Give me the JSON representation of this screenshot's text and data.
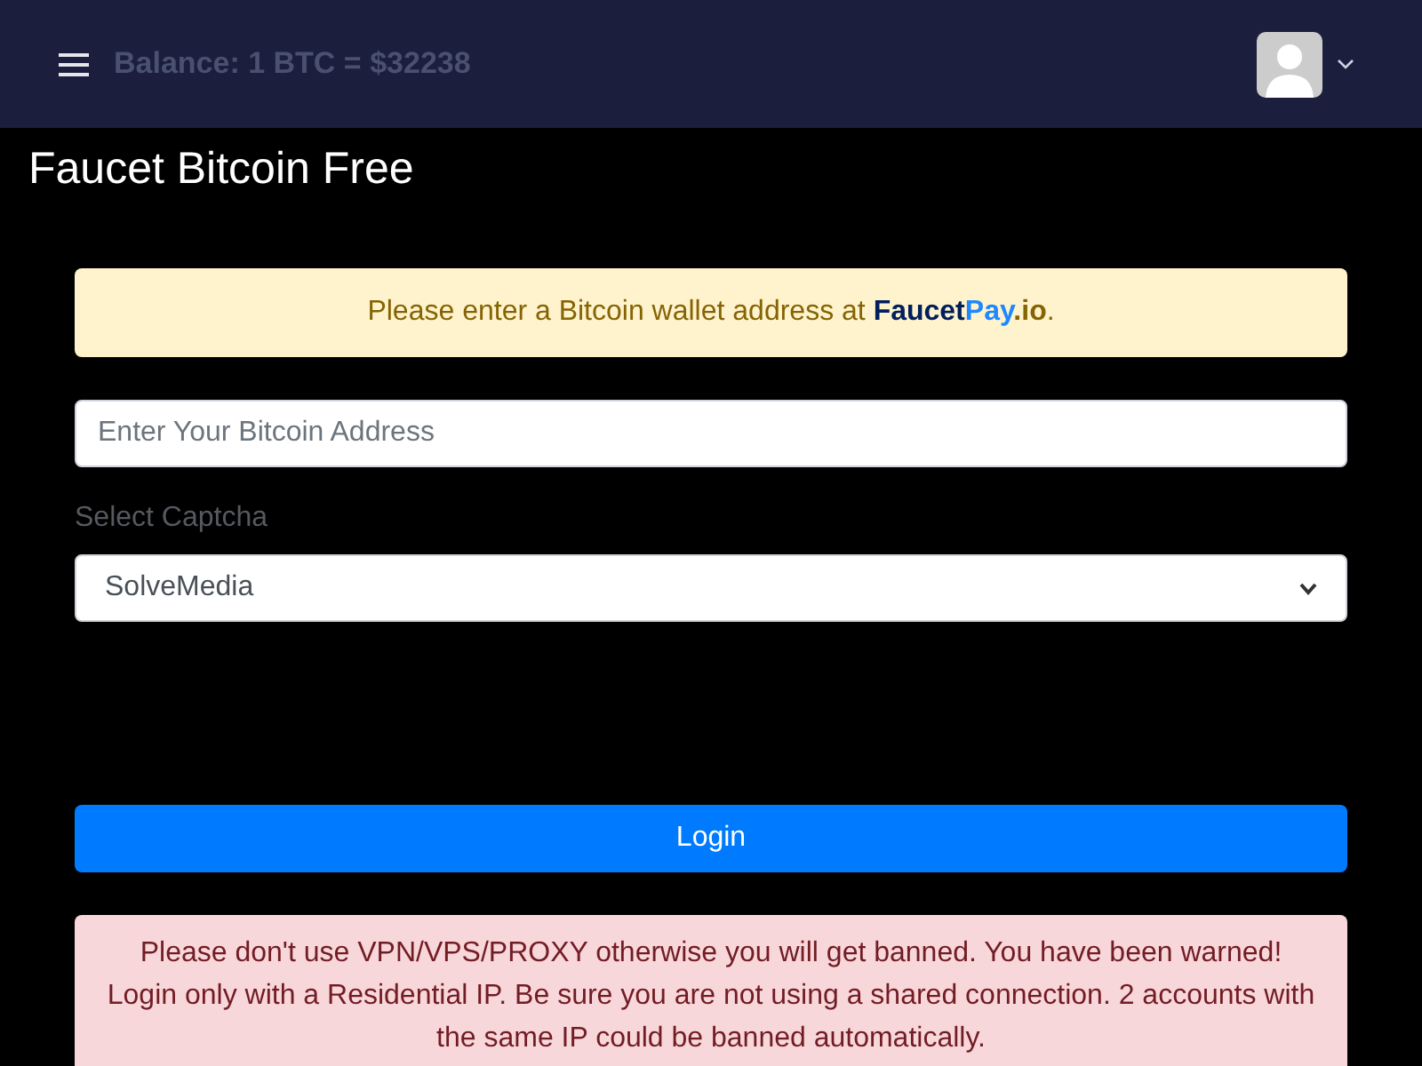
{
  "navbar": {
    "balance": "Balance: 1 BTC = $32238"
  },
  "page_title": "Faucet Bitcoin Free",
  "notice": {
    "text": "Please enter a Bitcoin wallet address at ",
    "link_parts": [
      "Faucet",
      "Pay",
      ".io"
    ],
    "end": "."
  },
  "address_field": {
    "placeholder": "Enter Your Bitcoin Address"
  },
  "captcha": {
    "label": "Select Captcha",
    "value": "SolveMedia"
  },
  "login_button": "Login",
  "warning": "Please don't use VPN/VPS/PROXY otherwise you will get banned. You have been warned! Login only with a Residential IP. Be sure you are not using a shared connection. 2 accounts with the same IP could be banned automatically."
}
